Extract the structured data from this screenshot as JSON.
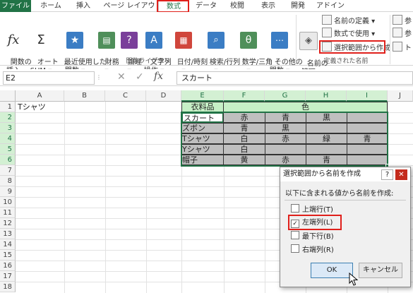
{
  "ribbon_tabs": [
    "ファイル",
    "ホーム",
    "挿入",
    "ページ レイアウト",
    "数式",
    "データ",
    "校閲",
    "表示",
    "開発",
    "アドイン"
  ],
  "ribbon": {
    "insert_function": "関数の\n挿入",
    "autosum": "オート\nSUM ▾",
    "recent": "最近使用した\n関数 ▾",
    "financial": "財務\n▾",
    "logical": "論理\n▾",
    "text": "文字列\n操作 ▾",
    "datetime": "日付/時刻\n▾",
    "lookup": "検索/行列\n▾",
    "math": "数学/三角\n▾",
    "more": "その他の\n関数 ▾",
    "group_library": "関数ライブラリ",
    "name_manager": "名前の\n管理",
    "define_name": "名前の定義 ▾",
    "use_in_formula": "数式で使用 ▾",
    "create_from_selection": "選択範囲から作成",
    "group_defined": "定義された名前",
    "trace1": "参",
    "trace2": "参",
    "trace3": "トレ"
  },
  "formula_bar": {
    "name_box": "E2",
    "formula": "スカート",
    "cancel_glyph": "✕",
    "enter_glyph": "✓",
    "fx_glyph": "fx"
  },
  "columns": [
    "A",
    "B",
    "C",
    "D",
    "E",
    "F",
    "G",
    "H",
    "I",
    "J"
  ],
  "rows": [
    "1",
    "2",
    "3",
    "4",
    "5",
    "6",
    "7",
    "8",
    "9",
    "10",
    "11",
    "12",
    "13",
    "14",
    "15",
    "16",
    "17",
    "18"
  ],
  "cells": {
    "A1": "Tシャツ",
    "E1": "衣料品",
    "F1": "色",
    "E2": "スカート",
    "F2": "赤",
    "G2": "青",
    "H2": "黒",
    "I2": "",
    "E3": "ズボン",
    "F3": "青",
    "G3": "黒",
    "H3": "",
    "I3": "",
    "E4": "Tシャツ",
    "F4": "白",
    "G4": "赤",
    "H4": "緑",
    "I4": "青",
    "E5": "Yシャツ",
    "F5": "白",
    "G5": "",
    "H5": "",
    "I5": "",
    "E6": "帽子",
    "F6": "黄",
    "G6": "赤",
    "H6": "青",
    "I6": ""
  },
  "dialog": {
    "title": "選択範囲から名前を作成",
    "help_glyph": "?",
    "close_glyph": "✕",
    "group_label": "以下に含まれる値から名前を作成:",
    "options": [
      {
        "label": "上端行(T)",
        "checked": false
      },
      {
        "label": "左端列(L)",
        "checked": true
      },
      {
        "label": "最下行(B)",
        "checked": false
      },
      {
        "label": "右端列(R)",
        "checked": false
      }
    ],
    "ok": "OK",
    "cancel": "キャンセル"
  },
  "colors": {
    "excel_green": "#217346",
    "highlight_red": "#e0201b",
    "header_fill": "#c6efc6",
    "gray_fill": "#bfbfbf"
  }
}
